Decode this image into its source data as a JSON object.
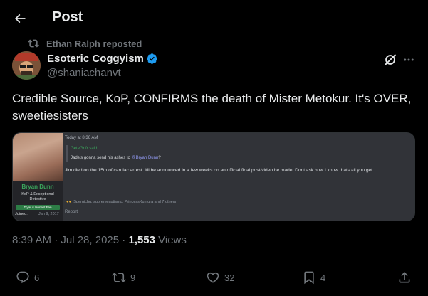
{
  "header": {
    "title": "Post"
  },
  "repost": {
    "text": "Ethan Ralph reposted"
  },
  "author": {
    "name": "Esoteric Coggyism",
    "handle": "@shaniachanvt"
  },
  "post": {
    "text": "Credible Source, KoP, CONFIRMS the death of Mister Metokur. It's OVER, sweetiesisters"
  },
  "embedded": {
    "user_name": "Bryan Dunn",
    "role_line1": "KoP & Exceptional",
    "role_line2": "Detective",
    "tag": "Tryar & Honest Fan",
    "joined_label": "Joined:",
    "joined_value": "Jan 9, 2017",
    "timestamp": "Today at 8:36 AM",
    "quote_said": "GeteGrifr said:",
    "quote_text": "Jade's gonna send his ashes to",
    "quote_mention": "@Bryan Dunn",
    "quote_suffix": "?",
    "message": "Jim died on the 15th of cardiac arrest. Itll be announced in a few weeks on an official final post/video he made. Dont ask how I know thats all you get.",
    "reactions": "Spergichu, supremeautismo, PrincessKumura and 7 others",
    "report": "Report"
  },
  "meta": {
    "time": "8:39 AM · Jul 28, 2025 · ",
    "views_count": "1,553",
    "views_label": " Views"
  },
  "actions": {
    "replies": "6",
    "reposts": "9",
    "likes": "32",
    "bookmarks": "4"
  },
  "colors": {
    "accent": "#1d9bf0",
    "muted": "#71767b",
    "text": "#e7e9ea",
    "background": "#000000"
  },
  "icons": [
    "back-arrow-icon",
    "repost-icon",
    "verified-badge-icon",
    "grok-icon",
    "more-icon",
    "reply-icon",
    "like-icon",
    "bookmark-icon",
    "share-icon"
  ]
}
